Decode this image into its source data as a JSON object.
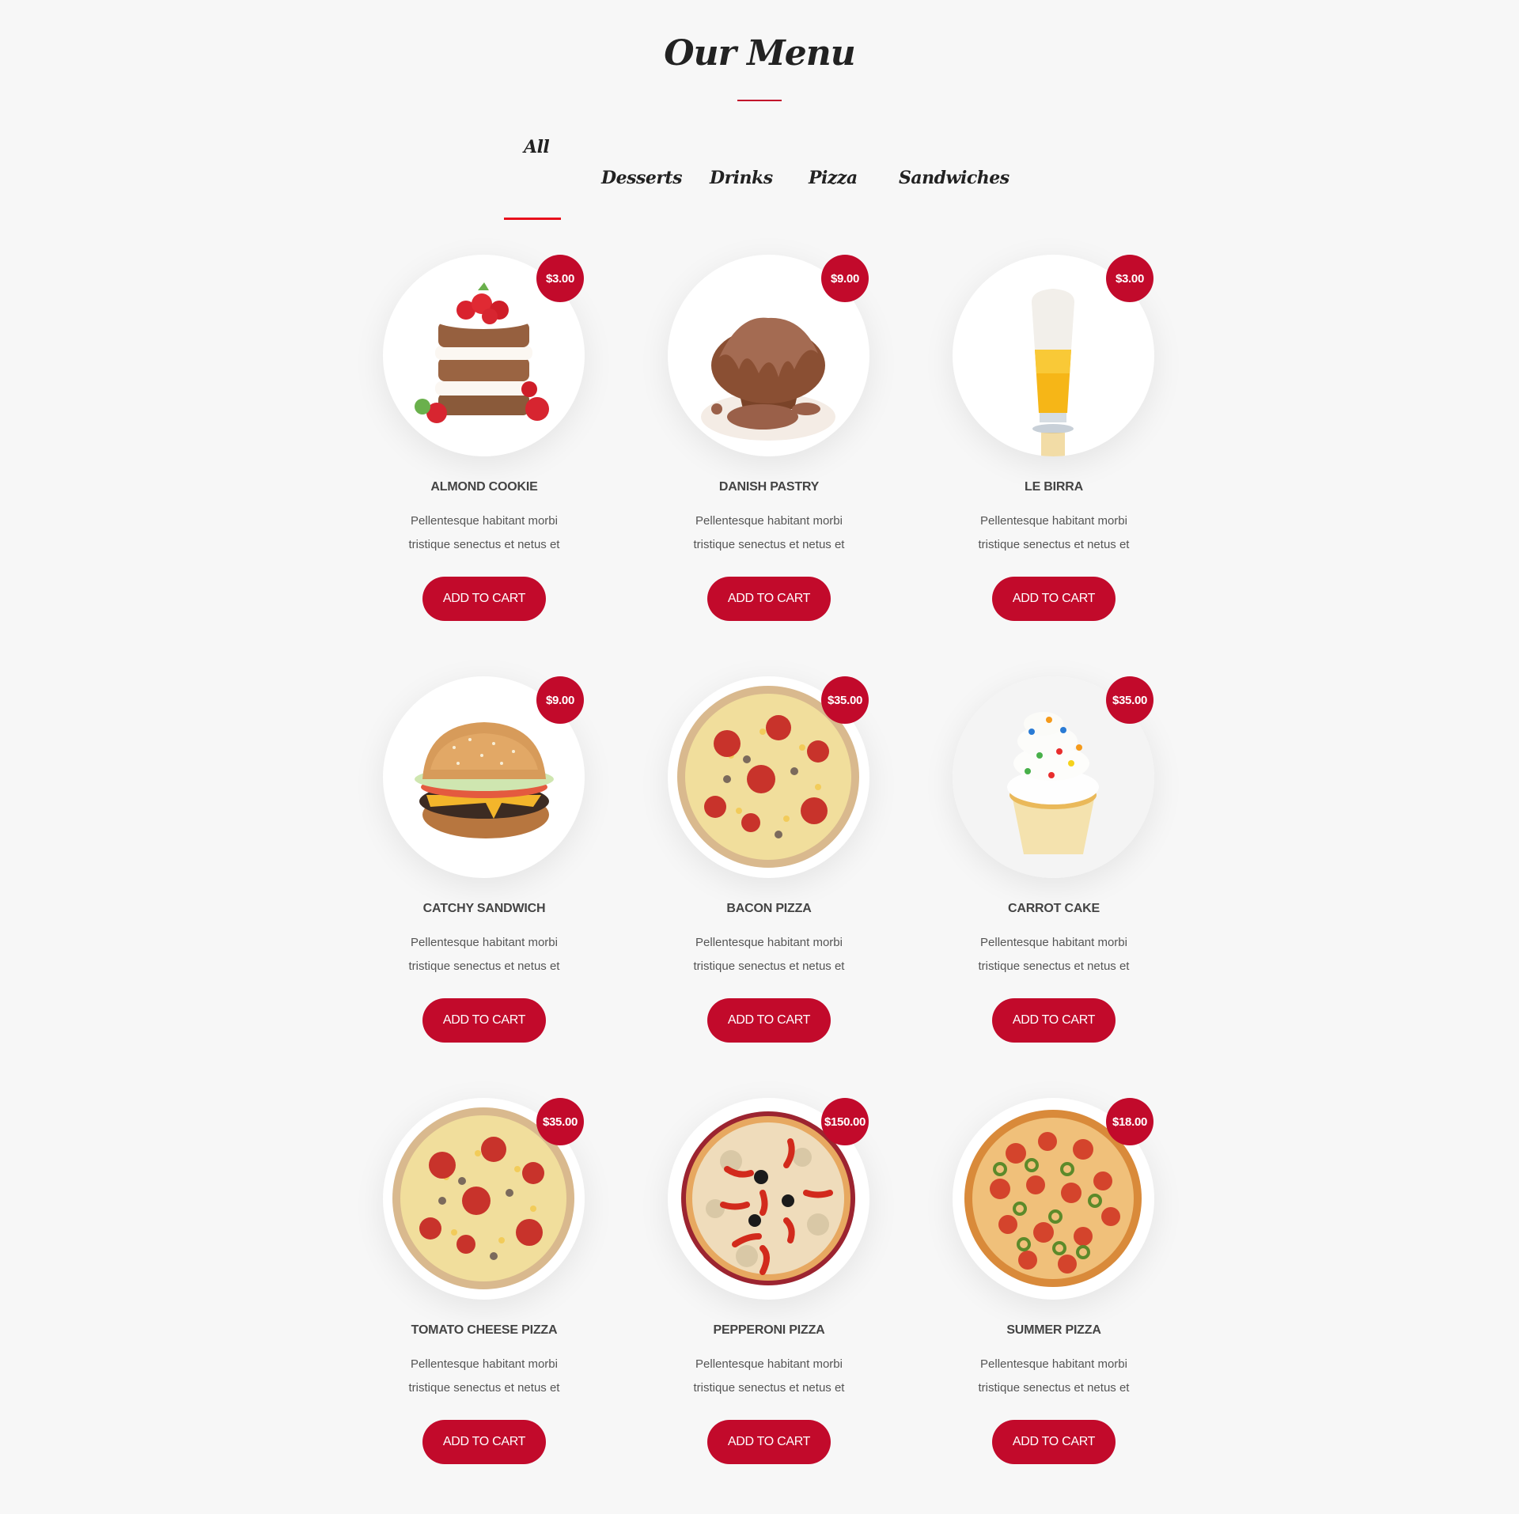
{
  "header": {
    "title": "Our Menu"
  },
  "tabs": [
    {
      "label": "All",
      "active": true
    },
    {
      "label": "Desserts",
      "active": false
    },
    {
      "label": "Drinks",
      "active": false
    },
    {
      "label": "Pizza",
      "active": false
    },
    {
      "label": "Sandwiches",
      "active": false
    }
  ],
  "colors": {
    "accent": "#c20a2b",
    "tab_active_underline": "#e8101c",
    "background": "#f7f7f7"
  },
  "items": [
    {
      "name": "Almond Cookie",
      "price": "$3.00",
      "image": "layer-cake",
      "desc_line1": "Pellentesque habitant morbi",
      "desc_line2": "tristique senectus et netus et",
      "button": "ADD TO CART"
    },
    {
      "name": "Danish Pastry",
      "price": "$9.00",
      "image": "chocolate-muffin",
      "desc_line1": "Pellentesque habitant morbi",
      "desc_line2": "tristique senectus et netus et",
      "button": "ADD TO CART"
    },
    {
      "name": "Le Birra",
      "price": "$3.00",
      "image": "beer-glass",
      "desc_line1": "Pellentesque habitant morbi",
      "desc_line2": "tristique senectus et netus et",
      "button": "ADD TO CART"
    },
    {
      "name": "Catchy Sandwich",
      "price": "$9.00",
      "image": "burger",
      "desc_line1": "Pellentesque habitant morbi",
      "desc_line2": "tristique senectus et netus et",
      "button": "ADD TO CART"
    },
    {
      "name": "Bacon Pizza",
      "price": "$35.00",
      "image": "tomato-pizza",
      "desc_line1": "Pellentesque habitant morbi",
      "desc_line2": "tristique senectus et netus et",
      "button": "ADD TO CART"
    },
    {
      "name": "Carrot Cake",
      "price": "$35.00",
      "image": "cupcake",
      "desc_line1": "Pellentesque habitant morbi",
      "desc_line2": "tristique senectus et netus et",
      "button": "ADD TO CART"
    },
    {
      "name": "Tomato Cheese Pizza",
      "price": "$35.00",
      "image": "tomato-pizza",
      "desc_line1": "Pellentesque habitant morbi",
      "desc_line2": "tristique senectus et netus et",
      "button": "ADD TO CART"
    },
    {
      "name": "Pepperoni Pizza",
      "price": "$150.00",
      "image": "pepper-pizza",
      "desc_line1": "Pellentesque habitant morbi",
      "desc_line2": "tristique senectus et netus et",
      "button": "ADD TO CART"
    },
    {
      "name": "Summer Pizza",
      "price": "$18.00",
      "image": "pepperoni-jalapeno-pizza",
      "desc_line1": "Pellentesque habitant morbi",
      "desc_line2": "tristique senectus et netus et",
      "button": "ADD TO CART"
    }
  ]
}
